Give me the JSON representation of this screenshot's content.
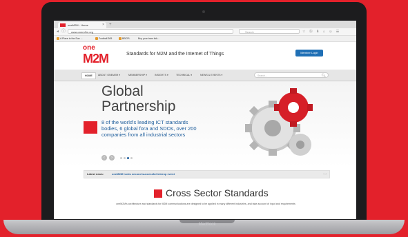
{
  "browser": {
    "tab_title": "oneM2M - Home",
    "tab_close": "×",
    "new_tab": "+",
    "url": "www.onem2m.org",
    "search_placeholder": "Search",
    "nav_back": "◂",
    "nav_info": "ⓘ",
    "toolbar_glyphs": "☆ ⓑ ⬇ ⌂ ☺ ☰",
    "bookmarks": [
      "A Place in the Sun ...",
      "Football 365",
      "BBCPL",
      "Buy your tram tick..."
    ]
  },
  "site": {
    "logo_top": "one",
    "logo_bottom": "M2M",
    "tagline": "Standards for M2M and the Internet of Things",
    "login_label": "Member Login",
    "menu": {
      "home": "HOME",
      "items": [
        "ABOUT ONEM2M ▾",
        "MEMBERSHIP ▾",
        "INSIGHTS ▾",
        "TECHNICAL ▾",
        "NEWS & EVENTS ▾"
      ]
    },
    "search_placeholder": "Search...",
    "search_icon": "🔍︎",
    "hero": {
      "title_line1": "Global",
      "title_line2": "Partnership",
      "text": "8 of the world's leading ICT standards bodies, 6 global fora and SDOs, over 200 companies from all industrial sectors",
      "prev_label": "‹",
      "next_label": "›"
    },
    "news": {
      "label": "Latest news:",
      "text": "oneM2M hosts second successful interop event",
      "nav": "‹ ›"
    },
    "cross": {
      "title": "Cross Sector Standards",
      "text": "oneM2M's architecture and standards for M2M communications are designed to be applied in many different industries, and take account of input and requirements"
    }
  },
  "laptop": {
    "brand": "MacBook"
  },
  "colors": {
    "background_red": "#e3212b",
    "accent_blue": "#1f6fb5"
  }
}
